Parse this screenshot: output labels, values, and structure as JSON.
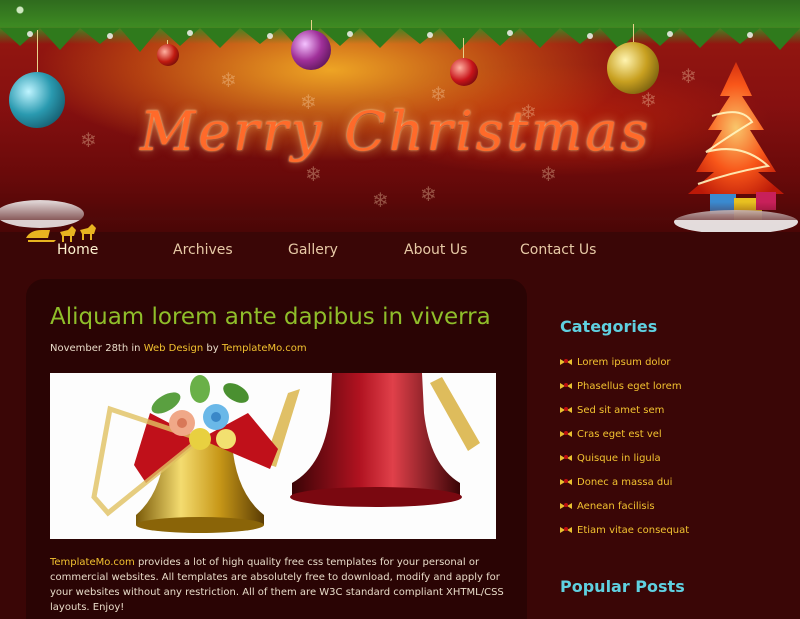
{
  "header": {
    "title": "Merry Christmas"
  },
  "nav": {
    "items": [
      {
        "label": "Home",
        "active": true
      },
      {
        "label": "Archives",
        "active": false
      },
      {
        "label": "Gallery",
        "active": false
      },
      {
        "label": "About Us",
        "active": false
      },
      {
        "label": "Contact Us",
        "active": false
      }
    ]
  },
  "post": {
    "title": "Aliquam lorem ante dapibus in viverra",
    "date": "November 28th",
    "in_word": "in",
    "category": "Web Design",
    "by_word": "by",
    "author": "TemplateMo.com",
    "body_link": "TemplateMo.com",
    "body_text": "provides a lot of high quality free css templates for your personal or commercial websites. All templates are absolutely free to download, modify and apply for your websites without any restriction. All of them are W3C standard compliant XHTML/CSS layouts. Enjoy!"
  },
  "sidebar": {
    "categories_title": "Categories",
    "categories": [
      "Lorem ipsum dolor",
      "Phasellus eget lorem",
      "Sed sit amet sem",
      "Cras eget est vel",
      "Quisque in ligula",
      "Donec a massa dui",
      "Aenean facilisis",
      "Etiam vitae consequat"
    ],
    "popular_title": "Popular Posts"
  },
  "colors": {
    "post_title": "#8fbe2a",
    "link": "#f2c230",
    "sidebar_title": "#5fd0e0",
    "background": "#3a0606"
  }
}
